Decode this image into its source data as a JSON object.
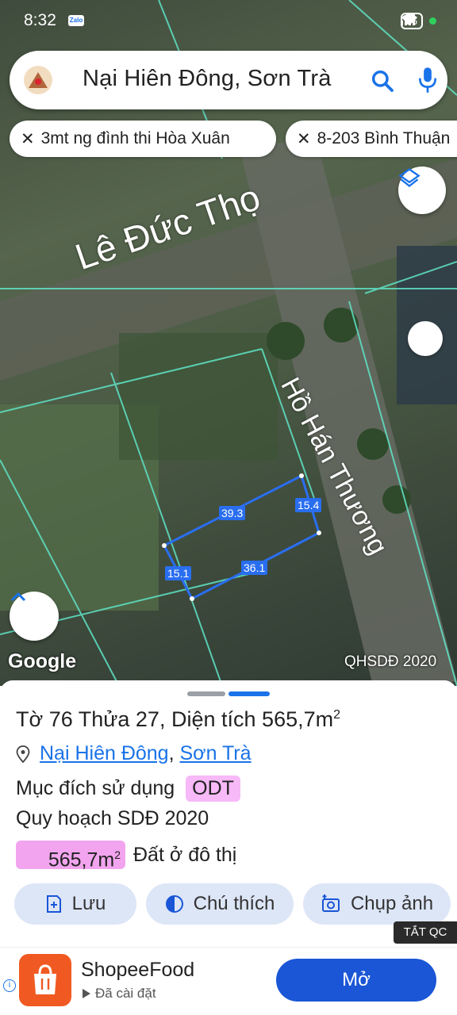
{
  "status_bar": {
    "time": "8:32",
    "app_badge": "Zalo",
    "battery": "86"
  },
  "search": {
    "query": "Nại Hiên Đông, Sơn Trà"
  },
  "saved_places": [
    {
      "label": "3mt ng đình thi  Hòa Xuân"
    },
    {
      "label": "8-203 Bình Thuận"
    }
  ],
  "map": {
    "street_labels": [
      "Lê Đức Thọ",
      "Hồ Hán Thương"
    ],
    "dimensions": [
      "39.3",
      "15.4",
      "15.1",
      "36.1"
    ],
    "google_logo": "Google",
    "layer_tag": "QHSDĐ 2020"
  },
  "parcel": {
    "sheet_label": "Tờ",
    "sheet_no": "76",
    "lot_label": "Thửa",
    "lot_no": "27",
    "area_label": "Diện tích",
    "area_value": "565,7m",
    "area_unit_sup": "2",
    "ward": "Nại Hiên Đông",
    "district": "Sơn Trà",
    "purpose_label": "Mục đích sử dụng",
    "purpose_code": "ODT",
    "plan_label": "Quy hoạch SDĐ 2020",
    "plan_area": "565,7m",
    "plan_area_sup": "2",
    "plan_type": "Đất ở đô thị",
    "badge_color": "#f7b9f7"
  },
  "actions": [
    {
      "label": "Lưu",
      "icon": "bookmark-plus-icon"
    },
    {
      "label": "Chú thích",
      "icon": "contrast-icon"
    },
    {
      "label": "Chụp ảnh",
      "icon": "add-photo-icon"
    }
  ],
  "ad": {
    "close_tag": "TẮT QC",
    "app_name": "ShopeeFood",
    "installed": "Đã cài đặt",
    "cta": "Mở",
    "brand_color": "#f05a22"
  }
}
